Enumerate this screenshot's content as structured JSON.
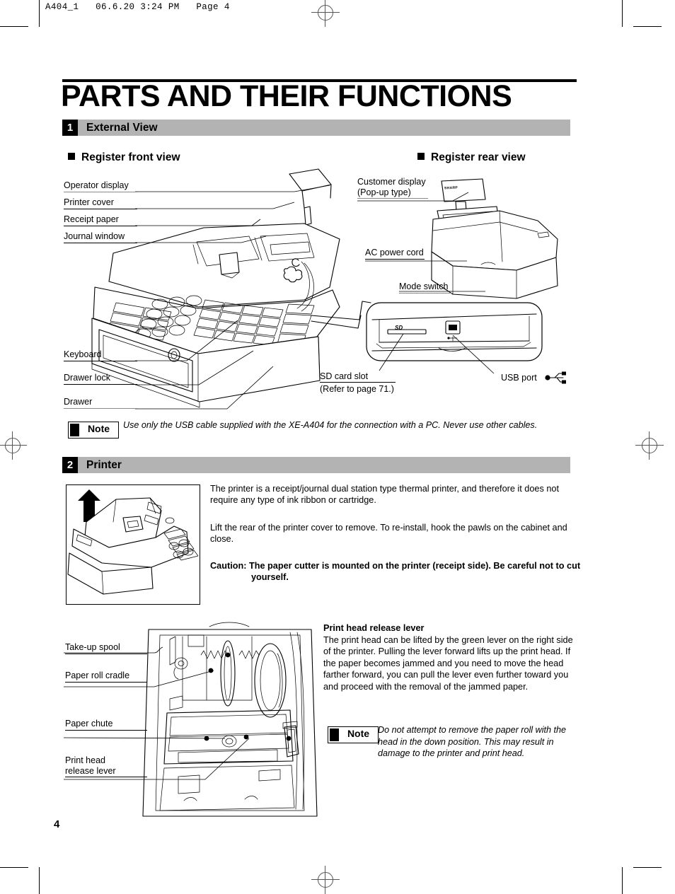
{
  "printer_slug": "A404_1   06.6.20 3:24 PM   Page 4",
  "page_number": "4",
  "title": "PARTS AND THEIR FUNCTIONS",
  "sections": [
    {
      "number": "1",
      "label": "External View"
    },
    {
      "number": "2",
      "label": "Printer"
    }
  ],
  "subheads": {
    "front_view": "Register front view",
    "rear_view": "Register rear view"
  },
  "front_callouts": [
    "Operator display",
    "Printer cover",
    "Receipt paper",
    "Journal window",
    "Keyboard",
    "Drawer lock",
    "Drawer"
  ],
  "rear_callouts": {
    "customer_display_line1": "Customer display",
    "customer_display_line2": "(Pop-up type)",
    "ac_power_cord": "AC power cord",
    "mode_switch": "Mode switch",
    "sd_card_slot": "SD card slot",
    "sd_card_ref": "(Refer to page 71.)",
    "usb_port": "USB port",
    "sd_logo": "SD"
  },
  "rear_brand": "SHARP",
  "note_label": "Note",
  "note_usb": "Use only the USB cable supplied with the XE-A404 for the connection with a PC.  Never use other cables.",
  "printer_body": {
    "para1": "The printer is a receipt/journal dual station type thermal printer, and therefore it does not require any type of ink ribbon or cartridge.",
    "para2": "Lift the rear of the printer cover to remove.  To re-install, hook the pawls on the cabinet and close.",
    "caution": "Caution: The paper cutter is mounted on the printer (receipt side).  Be careful not to cut yourself."
  },
  "mechanism_callouts": [
    "Take-up spool",
    "Paper roll cradle",
    "Paper chute",
    "Print head",
    "release lever"
  ],
  "release_lever": {
    "heading": "Print head release lever",
    "body": "The print head can be lifted by the green lever on the right side of the printer.  Pulling the lever forward lifts up the print head. If the paper becomes jammed and you need to move the head farther forward, you can pull the lever even further toward you and proceed with the removal of the jammed paper."
  },
  "note_paper_roll": "Do not attempt to remove the paper roll with the head in the down position.  This may result in damage to the printer and print head.",
  "colors": {
    "section_bar": "#b3b3b3",
    "ink": "#000000",
    "paper": "#ffffff",
    "reg_mark": "#555555"
  }
}
